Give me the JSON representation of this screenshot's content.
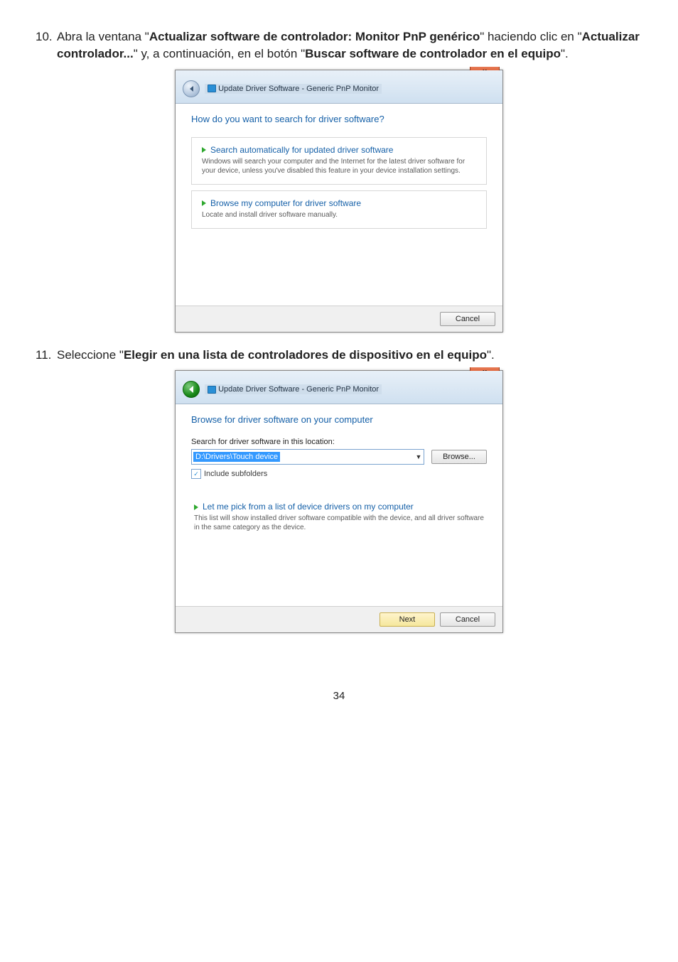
{
  "step10": {
    "num": "10.",
    "pre": "Abra la ventana \"",
    "b1": "Actualizar software de controlador: Monitor PnP genérico",
    "mid1": "\" haciendo clic en \"",
    "b2": "Actualizar controlador...",
    "mid2": "\" y, a continuación, en el botón \"",
    "b3": "Buscar software de controlador en el equipo",
    "end": "\"."
  },
  "dialog1": {
    "title": "Update Driver Software - Generic PnP Monitor",
    "close": "x",
    "heading": "How do you want to search for driver software?",
    "opt1_title": "Search automatically for updated driver software",
    "opt1_desc": "Windows will search your computer and the Internet for the latest driver software for your device, unless you've disabled this feature in your device installation settings.",
    "opt2_title": "Browse my computer for driver software",
    "opt2_desc": "Locate and install driver software manually.",
    "cancel": "Cancel"
  },
  "step11": {
    "num": "11.",
    "pre": "Seleccione \"",
    "b1": "Elegir en una lista de controladores de dispositivo en el equipo",
    "end": "\"."
  },
  "dialog2": {
    "title": "Update Driver Software - Generic PnP Monitor",
    "close": "x",
    "heading": "Browse for driver software on your computer",
    "search_label": "Search for driver software in this location:",
    "path": "D:\\Drivers\\Touch device",
    "browse": "Browse...",
    "include": "Include subfolders",
    "opt_title": "Let me pick from a list of device drivers on my computer",
    "opt_desc": "This list will show installed driver software compatible with the device, and all driver software in the same category as the device.",
    "next": "Next",
    "cancel": "Cancel"
  },
  "pagenum": "34"
}
